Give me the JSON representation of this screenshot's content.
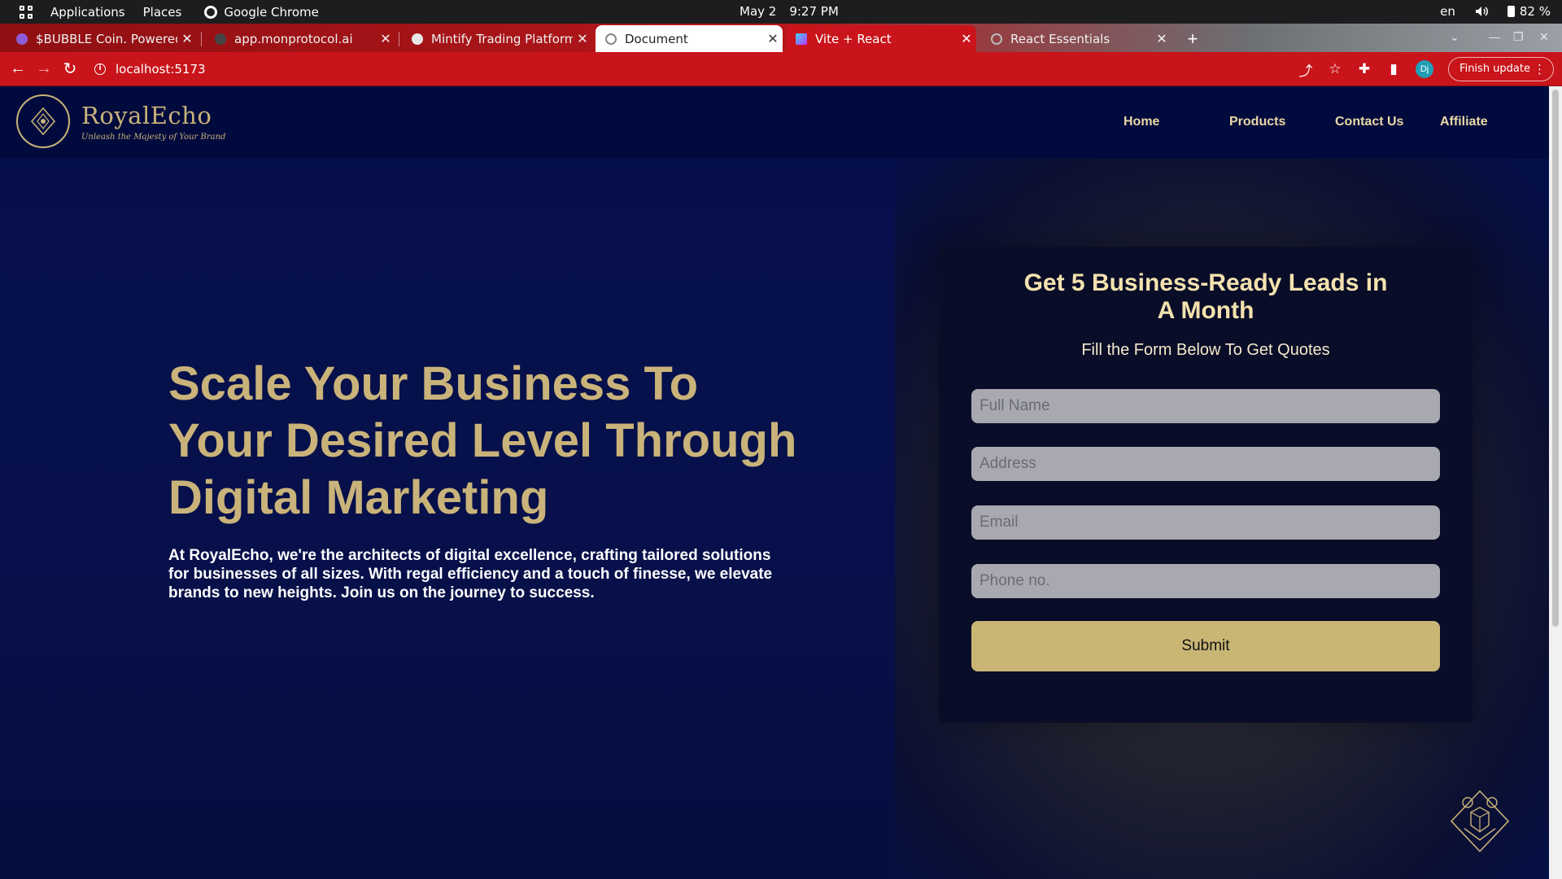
{
  "system_bar": {
    "applications": "Applications",
    "places": "Places",
    "app_name": "Google Chrome",
    "date": "May 2",
    "time": "9:27 PM",
    "language": "en",
    "battery": "82 %"
  },
  "tabs": [
    {
      "label": "$BUBBLE Coin. Powered",
      "color": "#8e5cd6"
    },
    {
      "label": "app.monprotocol.ai",
      "color": "#444444"
    },
    {
      "label": "Mintify Trading Platform",
      "color": "#e8e8e8"
    },
    {
      "label": "Document",
      "color": "#888888"
    },
    {
      "label": "Vite + React",
      "color": "#a259ff"
    },
    {
      "label": "React Essentials",
      "color": "#aaaaaa"
    }
  ],
  "address_bar": {
    "url": "localhost:5173",
    "finish_update": "Finish update",
    "avatar_initials": "Dj"
  },
  "site": {
    "brand_name": "RoyalEcho",
    "tagline": "Unleash the Majesty of Your Brand",
    "nav": [
      "Home",
      "Products",
      "Contact Us",
      "Affiliate"
    ],
    "hero_title": "Scale Your Business To Your Desired Level Through Digital Marketing",
    "hero_text": "At RoyalEcho, we're the architects of digital excellence, crafting tailored solutions for businesses of all sizes. With regal efficiency and a touch of finesse, we elevate brands to new heights. Join us on the journey to success.",
    "form": {
      "title_line1": "Get 5 Business-Ready Leads in",
      "title_line2": "A Month",
      "subtitle": "Fill the Form Below To Get Quotes",
      "full_name_placeholder": "Full Name",
      "address_placeholder": "Address",
      "email_placeholder": "Email",
      "phone_placeholder": "Phone no.",
      "submit_label": "Submit"
    },
    "accent_color": "#c9b37a",
    "background_color": "#061048"
  }
}
